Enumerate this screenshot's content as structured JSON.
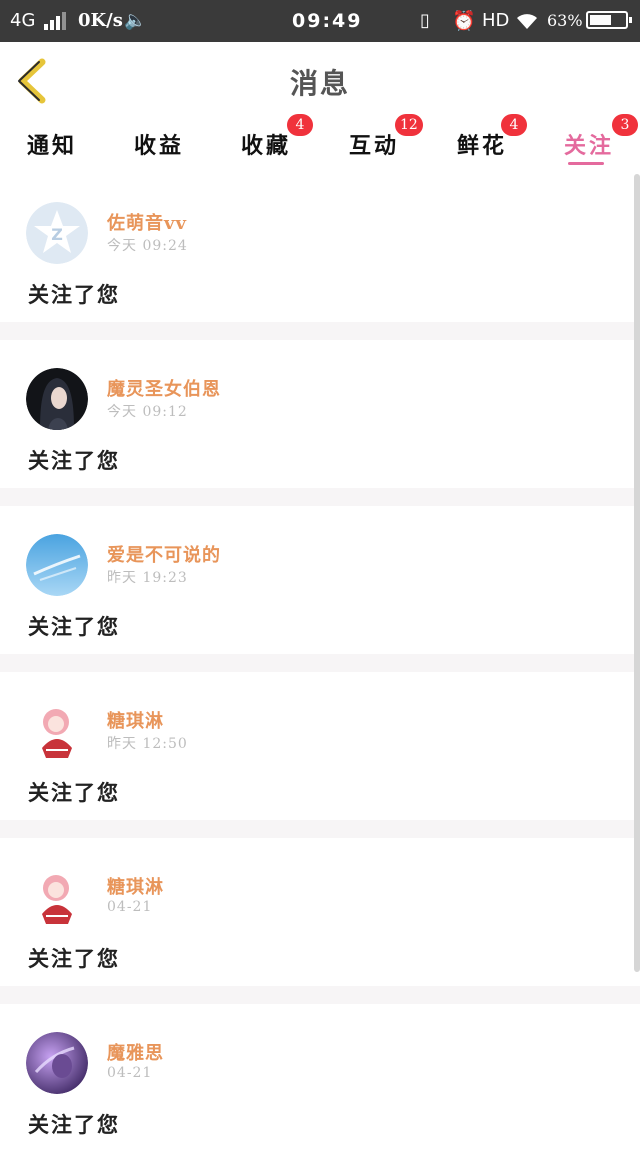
{
  "status_bar": {
    "network": "4G",
    "speed": "0K/s",
    "time": "09:49",
    "hd": "HD",
    "battery": "63%",
    "battery_level": 0.63
  },
  "header": {
    "title": "消息"
  },
  "tabs": [
    {
      "label": "通知",
      "badge": ""
    },
    {
      "label": "收益",
      "badge": ""
    },
    {
      "label": "收藏",
      "badge": "4"
    },
    {
      "label": "互动",
      "badge": "12"
    },
    {
      "label": "鲜花",
      "badge": "4"
    },
    {
      "label": "关注",
      "badge": "3",
      "active": true
    }
  ],
  "colors": {
    "accent": "#e46a9d",
    "name": "#e8955a",
    "badge": "#f0323c"
  },
  "messages": [
    {
      "name": "佐萌音vv",
      "time": "今天 09:24",
      "text": "关注了您",
      "avatar_icon": "default-star-avatar"
    },
    {
      "name": "魔灵圣女伯恩",
      "time": "今天 09:12",
      "text": "关注了您",
      "avatar_icon": "anime-girl-dark-avatar"
    },
    {
      "name": "爱是不可说的",
      "time": "昨天 19:23",
      "text": "关注了您",
      "avatar_icon": "sky-avatar"
    },
    {
      "name": "糖琪淋",
      "time": "昨天 12:50",
      "text": "关注了您",
      "avatar_icon": "pink-chibi-avatar"
    },
    {
      "name": "糖琪淋",
      "time": "04-21",
      "text": "关注了您",
      "avatar_icon": "pink-chibi-avatar"
    },
    {
      "name": "魔雅思",
      "time": "04-21",
      "text": "关注了您",
      "avatar_icon": "purple-anime-avatar"
    }
  ]
}
